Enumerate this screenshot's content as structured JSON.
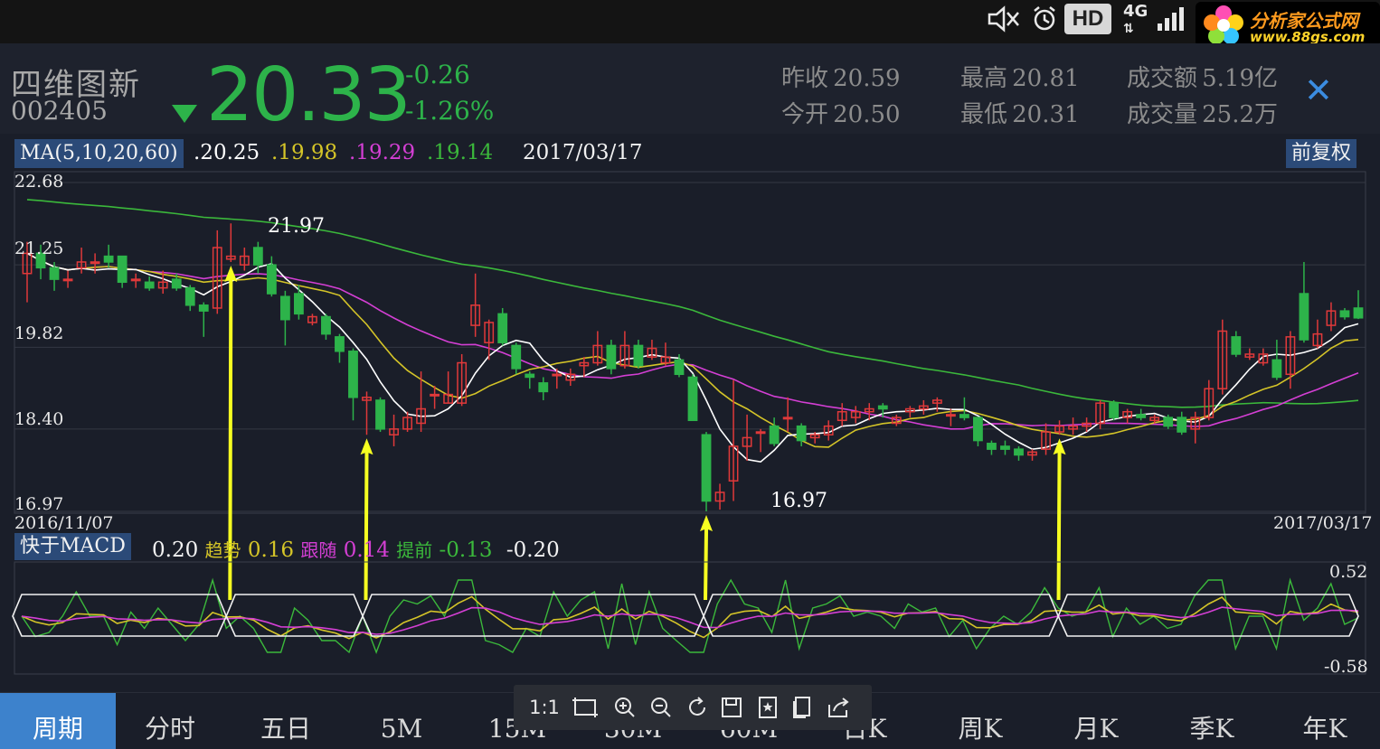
{
  "colors": {
    "up": "#e0393a",
    "down": "#2db34a",
    "ma5": "#ffffff",
    "ma10": "#d4c428",
    "ma20": "#d43fd4",
    "ma60": "#3bb83b",
    "arrow": "#f6ff21",
    "accent": "#3d82cc"
  },
  "status_bar": {
    "icons": [
      "mute-icon",
      "alarm-icon",
      "hd-icon",
      "4g-icon",
      "signal-icon"
    ],
    "hd": "HD",
    "network": "4G"
  },
  "watermark": {
    "title": "分析家公式网",
    "url": "www.88gs.com"
  },
  "header": {
    "name": "四维图新",
    "code": "002405",
    "price": "20.33",
    "change": "-0.26",
    "change_pct": "-1.26%",
    "stats": [
      {
        "label": "昨收",
        "value": "20.59"
      },
      {
        "label": "今开",
        "value": "20.50"
      },
      {
        "label": "最高",
        "value": "20.81"
      },
      {
        "label": "最低",
        "value": "20.31"
      },
      {
        "label": "成交额",
        "value": "5.19亿"
      },
      {
        "label": "成交量",
        "value": "25.2万"
      }
    ],
    "close_icon": "close-icon"
  },
  "main_chart": {
    "indicator_label": "MA(5,10,20,60)",
    "ma_values": [
      ".20.25",
      ".19.98",
      ".19.29",
      ".19.14"
    ],
    "date": "2017/03/17",
    "adjust_button": "前复权",
    "y_labels": [
      "22.68",
      "21.25",
      "19.82",
      "18.40",
      "16.97"
    ],
    "start_date": "2016/11/07",
    "end_date": "2017/03/17",
    "high_label": "21.97",
    "low_label": "16.97"
  },
  "sub_chart": {
    "indicator_label": "快于MACD",
    "values": [
      {
        "name": "",
        "value": "0.20"
      },
      {
        "name": "趋势",
        "value": "0.16"
      },
      {
        "name": "跟随",
        "value": "0.14"
      },
      {
        "name": "提前",
        "value": "-0.13"
      },
      {
        "name": "",
        "value": "-0.20"
      }
    ],
    "y_max": "0.52",
    "y_min": "-0.58"
  },
  "toolbar": {
    "ratio": "1:1",
    "icons": [
      "crop-icon",
      "zoom-in-icon",
      "zoom-out-icon",
      "rotate-icon",
      "save-icon",
      "bookmark-icon",
      "copy-icon",
      "share-icon"
    ]
  },
  "tabs": [
    {
      "label": "周期",
      "active": true
    },
    {
      "label": "分时",
      "active": false
    },
    {
      "label": "五日",
      "active": false
    },
    {
      "label": "5M",
      "active": false
    },
    {
      "label": "15M",
      "active": false
    },
    {
      "label": "30M",
      "active": false
    },
    {
      "label": "60M",
      "active": false
    },
    {
      "label": "日K",
      "active": false
    },
    {
      "label": "周K",
      "active": false
    },
    {
      "label": "月K",
      "active": false
    },
    {
      "label": "季K",
      "active": false
    },
    {
      "label": "年K",
      "active": false
    }
  ],
  "chart_data": {
    "type": "candlestick",
    "x_range": [
      "2016/11/07",
      "2017/03/17"
    ],
    "ylim": [
      16.97,
      22.68
    ],
    "y_ticks": [
      22.68,
      21.25,
      19.82,
      18.4,
      16.97
    ],
    "candles": [
      {
        "o": 21.1,
        "c": 21.45,
        "h": 21.65,
        "l": 20.6
      },
      {
        "o": 21.45,
        "c": 21.2,
        "h": 21.6,
        "l": 21.0
      },
      {
        "o": 21.2,
        "c": 21.0,
        "h": 21.3,
        "l": 20.8
      },
      {
        "o": 21.0,
        "c": 21.0,
        "h": 21.15,
        "l": 20.85
      },
      {
        "o": 21.2,
        "c": 21.3,
        "h": 21.55,
        "l": 21.1
      },
      {
        "o": 21.3,
        "c": 21.3,
        "h": 21.45,
        "l": 21.1
      },
      {
        "o": 21.4,
        "c": 21.3,
        "h": 21.6,
        "l": 21.2
      },
      {
        "o": 21.4,
        "c": 20.95,
        "h": 21.4,
        "l": 20.85
      },
      {
        "o": 21.0,
        "c": 21.0,
        "h": 21.1,
        "l": 20.85
      },
      {
        "o": 20.95,
        "c": 20.85,
        "h": 21.05,
        "l": 20.8
      },
      {
        "o": 20.85,
        "c": 20.95,
        "h": 21.15,
        "l": 20.75
      },
      {
        "o": 21.0,
        "c": 20.85,
        "h": 21.1,
        "l": 20.8
      },
      {
        "o": 20.85,
        "c": 20.55,
        "h": 20.9,
        "l": 20.45
      },
      {
        "o": 20.55,
        "c": 20.45,
        "h": 20.6,
        "l": 20.0
      },
      {
        "o": 20.5,
        "c": 21.55,
        "h": 21.85,
        "l": 20.4
      },
      {
        "o": 21.35,
        "c": 21.4,
        "h": 21.97,
        "l": 21.3
      },
      {
        "o": 21.25,
        "c": 21.4,
        "h": 21.55,
        "l": 21.15
      },
      {
        "o": 21.55,
        "c": 21.25,
        "h": 21.65,
        "l": 21.1
      },
      {
        "o": 21.25,
        "c": 20.75,
        "h": 21.4,
        "l": 20.7
      },
      {
        "o": 20.7,
        "c": 20.3,
        "h": 20.8,
        "l": 19.85
      },
      {
        "o": 20.75,
        "c": 20.4,
        "h": 20.9,
        "l": 20.3
      },
      {
        "o": 20.25,
        "c": 20.35,
        "h": 20.4,
        "l": 20.2
      },
      {
        "o": 20.35,
        "c": 20.05,
        "h": 20.4,
        "l": 19.95
      },
      {
        "o": 20.0,
        "c": 19.75,
        "h": 20.05,
        "l": 19.55
      },
      {
        "o": 19.75,
        "c": 18.95,
        "h": 19.8,
        "l": 18.55
      },
      {
        "o": 18.9,
        "c": 18.95,
        "h": 19.05,
        "l": 18.3
      },
      {
        "o": 18.9,
        "c": 18.4,
        "h": 18.95,
        "l": 18.35
      },
      {
        "o": 18.3,
        "c": 18.4,
        "h": 18.65,
        "l": 18.1
      },
      {
        "o": 18.4,
        "c": 18.6,
        "h": 18.7,
        "l": 18.35
      },
      {
        "o": 18.5,
        "c": 18.75,
        "h": 19.4,
        "l": 18.35
      },
      {
        "o": 19.0,
        "c": 19.0,
        "h": 19.15,
        "l": 18.75
      },
      {
        "o": 18.85,
        "c": 19.0,
        "h": 19.4,
        "l": 18.85
      },
      {
        "o": 18.85,
        "c": 19.55,
        "h": 19.7,
        "l": 18.8
      },
      {
        "o": 20.2,
        "c": 20.55,
        "h": 21.1,
        "l": 20.0
      },
      {
        "o": 19.9,
        "c": 20.25,
        "h": 20.3,
        "l": 19.6
      },
      {
        "o": 20.4,
        "c": 19.9,
        "h": 20.5,
        "l": 19.85
      },
      {
        "o": 19.85,
        "c": 19.45,
        "h": 19.9,
        "l": 19.35
      },
      {
        "o": 19.35,
        "c": 19.3,
        "h": 19.4,
        "l": 19.1
      },
      {
        "o": 19.2,
        "c": 19.05,
        "h": 19.3,
        "l": 18.9
      },
      {
        "o": 19.35,
        "c": 19.35,
        "h": 19.45,
        "l": 19.1
      },
      {
        "o": 19.25,
        "c": 19.35,
        "h": 19.45,
        "l": 19.15
      },
      {
        "o": 19.5,
        "c": 19.55,
        "h": 19.65,
        "l": 19.3
      },
      {
        "o": 19.55,
        "c": 19.85,
        "h": 20.1,
        "l": 19.5
      },
      {
        "o": 19.85,
        "c": 19.45,
        "h": 19.95,
        "l": 19.35
      },
      {
        "o": 19.5,
        "c": 19.85,
        "h": 20.1,
        "l": 19.45
      },
      {
        "o": 19.85,
        "c": 19.5,
        "h": 19.95,
        "l": 19.45
      },
      {
        "o": 19.65,
        "c": 19.8,
        "h": 19.95,
        "l": 19.6
      },
      {
        "o": 19.55,
        "c": 19.65,
        "h": 19.9,
        "l": 19.5
      },
      {
        "o": 19.6,
        "c": 19.35,
        "h": 19.7,
        "l": 19.3
      },
      {
        "o": 19.3,
        "c": 18.55,
        "h": 19.35,
        "l": 18.55
      },
      {
        "o": 18.3,
        "c": 17.15,
        "h": 18.35,
        "l": 16.97
      },
      {
        "o": 17.15,
        "c": 17.3,
        "h": 17.45,
        "l": 17.0
      },
      {
        "o": 17.5,
        "c": 18.1,
        "h": 19.25,
        "l": 17.15
      },
      {
        "o": 18.1,
        "c": 18.25,
        "h": 18.65,
        "l": 17.85
      },
      {
        "o": 18.35,
        "c": 18.35,
        "h": 18.4,
        "l": 18.0
      },
      {
        "o": 18.45,
        "c": 18.15,
        "h": 18.6,
        "l": 18.1
      },
      {
        "o": 18.6,
        "c": 18.6,
        "h": 18.95,
        "l": 18.35
      },
      {
        "o": 18.45,
        "c": 18.2,
        "h": 18.5,
        "l": 18.1
      },
      {
        "o": 18.25,
        "c": 18.3,
        "h": 18.35,
        "l": 18.15
      },
      {
        "o": 18.3,
        "c": 18.45,
        "h": 18.55,
        "l": 18.2
      },
      {
        "o": 18.55,
        "c": 18.7,
        "h": 18.85,
        "l": 18.45
      },
      {
        "o": 18.6,
        "c": 18.7,
        "h": 18.8,
        "l": 18.5
      },
      {
        "o": 18.7,
        "c": 18.75,
        "h": 18.85,
        "l": 18.55
      },
      {
        "o": 18.8,
        "c": 18.75,
        "h": 18.85,
        "l": 18.6
      },
      {
        "o": 18.5,
        "c": 18.6,
        "h": 18.65,
        "l": 18.45
      },
      {
        "o": 18.7,
        "c": 18.75,
        "h": 18.8,
        "l": 18.6
      },
      {
        "o": 18.75,
        "c": 18.8,
        "h": 18.9,
        "l": 18.65
      },
      {
        "o": 18.85,
        "c": 18.9,
        "h": 18.95,
        "l": 18.7
      },
      {
        "o": 18.65,
        "c": 18.65,
        "h": 18.75,
        "l": 18.45
      },
      {
        "o": 18.65,
        "c": 18.6,
        "h": 18.95,
        "l": 18.55
      },
      {
        "o": 18.6,
        "c": 18.2,
        "h": 18.6,
        "l": 18.1
      },
      {
        "o": 18.15,
        "c": 18.05,
        "h": 18.2,
        "l": 17.95
      },
      {
        "o": 18.1,
        "c": 18.05,
        "h": 18.2,
        "l": 17.95
      },
      {
        "o": 18.05,
        "c": 17.95,
        "h": 18.1,
        "l": 17.85
      },
      {
        "o": 17.95,
        "c": 18.0,
        "h": 18.05,
        "l": 17.85
      },
      {
        "o": 18.05,
        "c": 18.35,
        "h": 18.5,
        "l": 17.95
      },
      {
        "o": 18.35,
        "c": 18.45,
        "h": 18.55,
        "l": 18.3
      },
      {
        "o": 18.4,
        "c": 18.45,
        "h": 18.6,
        "l": 18.3
      },
      {
        "o": 18.45,
        "c": 18.5,
        "h": 18.6,
        "l": 18.35
      },
      {
        "o": 18.5,
        "c": 18.85,
        "h": 18.9,
        "l": 18.4
      },
      {
        "o": 18.85,
        "c": 18.6,
        "h": 18.9,
        "l": 18.55
      },
      {
        "o": 18.6,
        "c": 18.7,
        "h": 18.75,
        "l": 18.5
      },
      {
        "o": 18.65,
        "c": 18.6,
        "h": 18.75,
        "l": 18.55
      },
      {
        "o": 18.55,
        "c": 18.6,
        "h": 18.65,
        "l": 18.5
      },
      {
        "o": 18.6,
        "c": 18.45,
        "h": 18.65,
        "l": 18.4
      },
      {
        "o": 18.6,
        "c": 18.35,
        "h": 18.7,
        "l": 18.3
      },
      {
        "o": 18.4,
        "c": 18.6,
        "h": 18.7,
        "l": 18.15
      },
      {
        "o": 18.6,
        "c": 19.1,
        "h": 19.25,
        "l": 18.55
      },
      {
        "o": 19.1,
        "c": 20.1,
        "h": 20.3,
        "l": 19.0
      },
      {
        "o": 20.0,
        "c": 19.7,
        "h": 20.1,
        "l": 19.65
      },
      {
        "o": 19.65,
        "c": 19.7,
        "h": 19.8,
        "l": 19.6
      },
      {
        "o": 19.55,
        "c": 19.7,
        "h": 19.8,
        "l": 19.5
      },
      {
        "o": 19.6,
        "c": 19.3,
        "h": 19.95,
        "l": 19.25
      },
      {
        "o": 19.35,
        "c": 20.0,
        "h": 20.1,
        "l": 19.1
      },
      {
        "o": 20.75,
        "c": 19.95,
        "h": 21.3,
        "l": 19.9
      },
      {
        "o": 19.85,
        "c": 20.05,
        "h": 20.3,
        "l": 19.8
      },
      {
        "o": 20.2,
        "c": 20.45,
        "h": 20.6,
        "l": 20.1
      },
      {
        "o": 20.45,
        "c": 20.35,
        "h": 20.5,
        "l": 20.3
      },
      {
        "o": 20.5,
        "c": 20.33,
        "h": 20.81,
        "l": 20.31
      }
    ],
    "annotations": [
      {
        "text": "21.97",
        "type": "high"
      },
      {
        "text": "16.97",
        "type": "low"
      }
    ],
    "signal_arrows_at_index": [
      15,
      25,
      50,
      76
    ]
  }
}
